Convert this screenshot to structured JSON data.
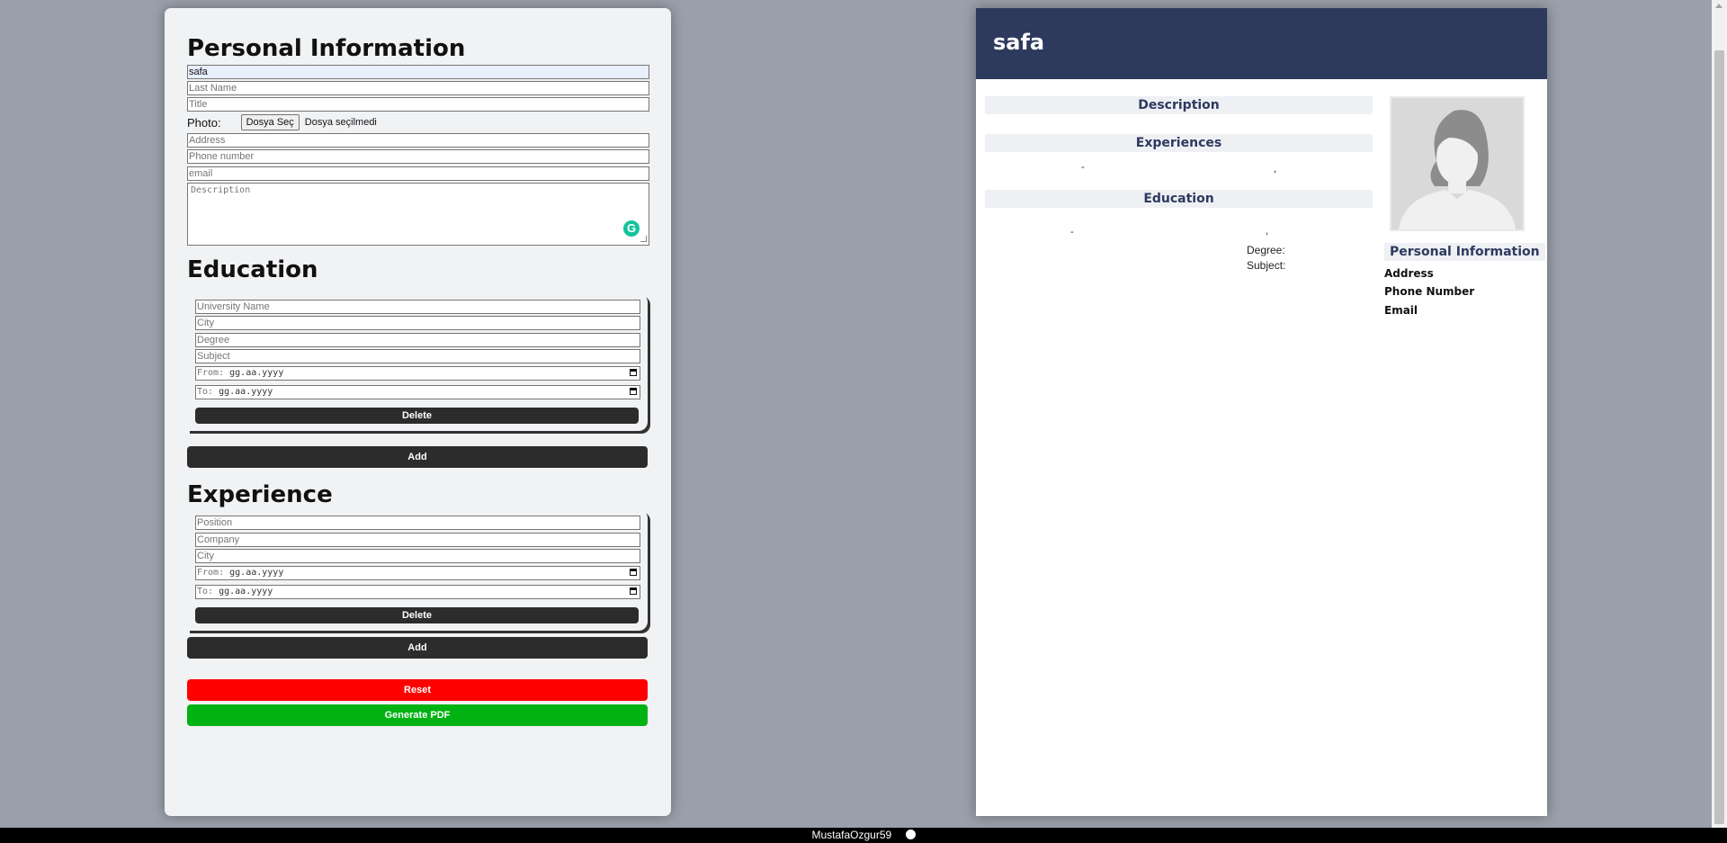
{
  "form": {
    "personal": {
      "heading": "Personal Information",
      "first_name_value": "safa",
      "last_name_placeholder": "Last Name",
      "title_placeholder": "Title",
      "photo_label": "Photo:",
      "file_button": "Dosya Seç",
      "file_status": "Dosya seçilmedi",
      "address_placeholder": "Address",
      "phone_placeholder": "Phone number",
      "email_placeholder": "email",
      "description_placeholder": "Description"
    },
    "education": {
      "heading": "Education",
      "university_placeholder": "University Name",
      "city_placeholder": "City",
      "degree_placeholder": "Degree",
      "subject_placeholder": "Subject",
      "from_label": "From:",
      "to_label": "To:",
      "date_placeholder": "gg.aa.yyyy",
      "delete_label": "Delete",
      "add_label": "Add"
    },
    "experience": {
      "heading": "Experience",
      "position_placeholder": "Position",
      "company_placeholder": "Company",
      "city_placeholder": "City",
      "from_label": "From:",
      "to_label": "To:",
      "date_placeholder": "gg.aa.yyyy",
      "delete_label": "Delete",
      "add_label": "Add"
    },
    "reset_label": "Reset",
    "generate_pdf_label": "Generate PDF"
  },
  "preview": {
    "name": "safa",
    "description_heading": "Description",
    "experiences_heading": "Experiences",
    "experience_dash": "-",
    "experience_comma": ",",
    "education_heading": "Education",
    "education_dash": "-",
    "education_comma": ",",
    "degree_label": "Degree:",
    "subject_label": "Subject:",
    "personal_info_heading": "Personal Information",
    "address_label": "Address",
    "phone_label": "Phone Number",
    "email_label": "Email"
  },
  "footer": {
    "author": "MustafaOzgur59",
    "icon": "github-icon"
  },
  "colors": {
    "header_bg": "#2d3a5e",
    "reset_bg": "#ff0000",
    "generate_bg": "#00b312",
    "button_dark": "#2c2c2c"
  }
}
